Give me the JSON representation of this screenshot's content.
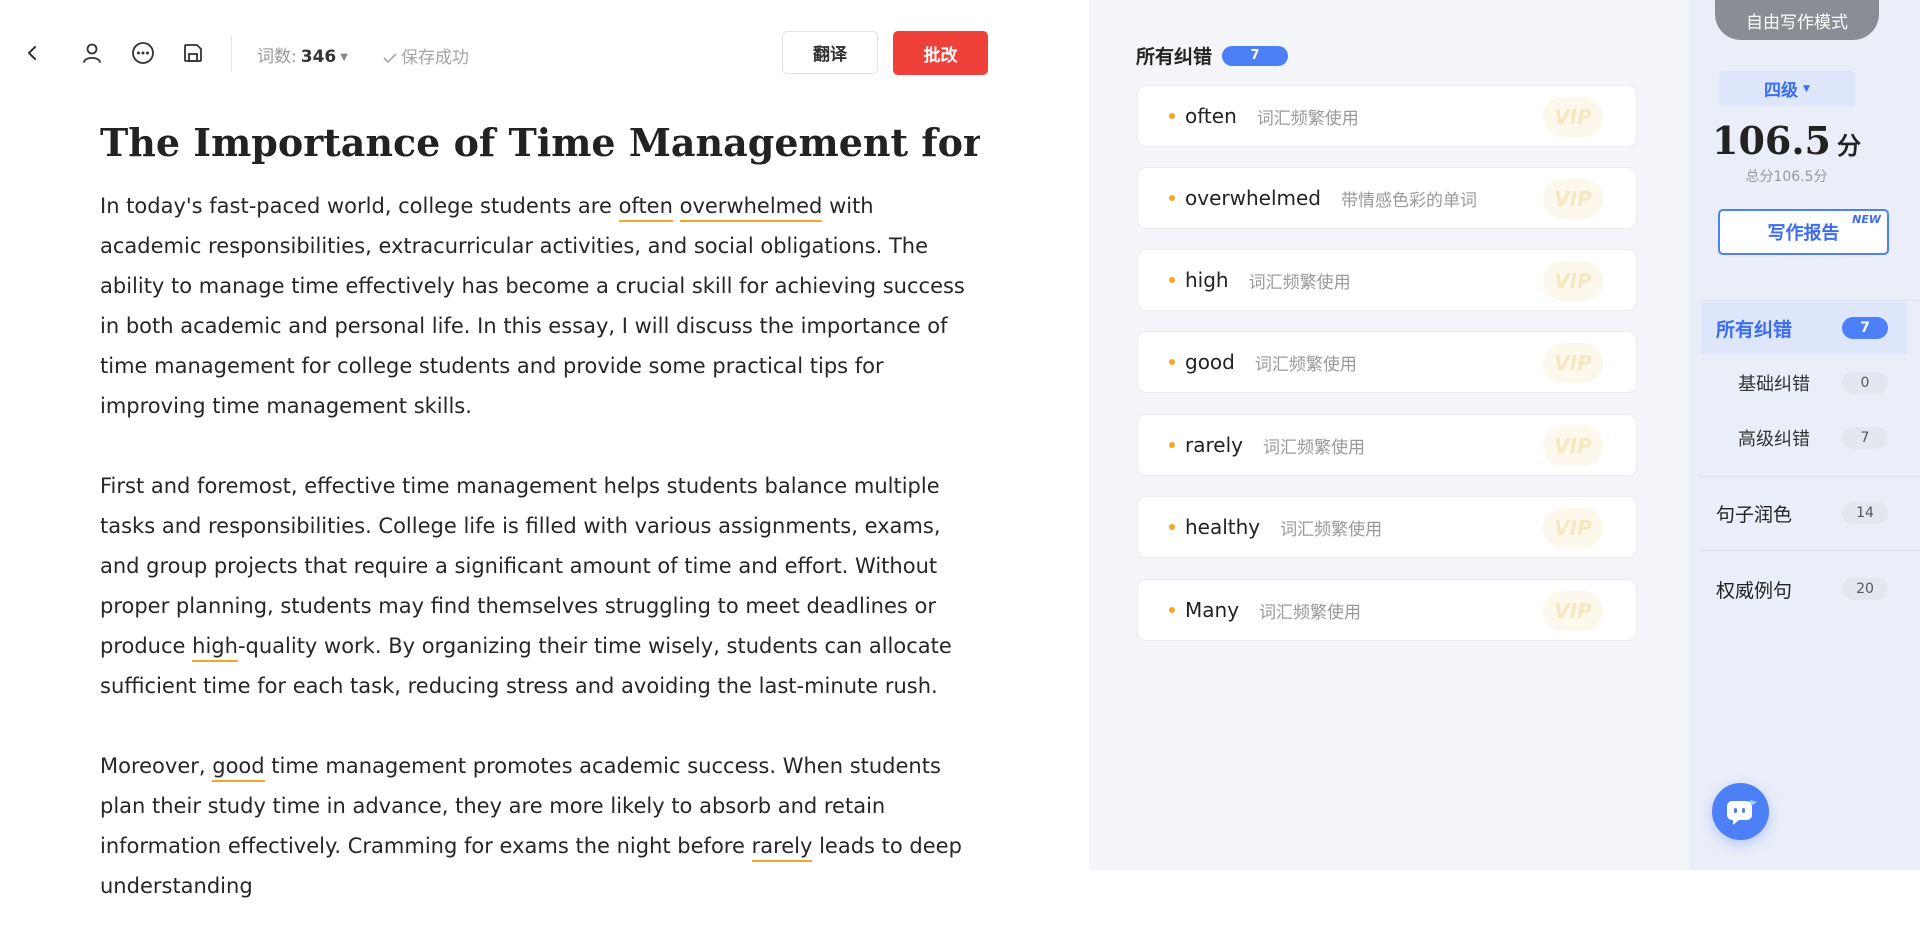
{
  "toolbar": {
    "word_count_label": "词数:",
    "word_count_value": "346",
    "save_status": "保存成功",
    "translate_label": "翻译",
    "correct_label": "批改"
  },
  "document": {
    "title": "The Importance of Time Management for Coll...",
    "p1": {
      "s1": "In today's fast-paced world, college students are ",
      "w1": "often",
      "s2": " ",
      "w2": "overwhelmed",
      "s3": " with academic responsibilities, extracurricular activities, and social obligations. The ability to manage time effectively has become a crucial skill for achieving success in both academic and personal life. In this essay, I will discuss the importance of time management for college students and provide some practical tips for improving time management skills."
    },
    "p2": {
      "s1": "First and foremost, effective time management helps students balance multiple tasks and responsibilities. College life is filled with various assignments, exams, and group projects that require a significant amount of time and effort. Without proper planning, students may find themselves struggling to meet deadlines or produce ",
      "w1": "high",
      "s2": "-quality work. By organizing their time wisely, students can allocate sufficient time for each task, reducing stress and avoiding the last-minute rush."
    },
    "p3": {
      "s1": "Moreover, ",
      "w1": "good",
      "s2": " time management promotes academic success. When students plan their study time in advance, they are more likely to absorb and retain information effectively. Cramming for exams the night before ",
      "w2": "rarely",
      "s3": " leads to deep understanding"
    }
  },
  "errors_panel": {
    "title": "所有纠错",
    "count": "7",
    "vip_label": "VIP",
    "items": [
      {
        "word": "often",
        "type": "词汇频繁使用"
      },
      {
        "word": "overwhelmed",
        "type": "带情感色彩的单词"
      },
      {
        "word": "high",
        "type": "词汇频繁使用"
      },
      {
        "word": "good",
        "type": "词汇频繁使用"
      },
      {
        "word": "rarely",
        "type": "词汇频繁使用"
      },
      {
        "word": "healthy",
        "type": "词汇频繁使用"
      },
      {
        "word": "Many",
        "type": "词汇频繁使用"
      }
    ]
  },
  "sidebar": {
    "mode_label": "自由写作模式",
    "level": "四级",
    "score": "106.5",
    "score_unit": "分",
    "score_sub": "总分106.5分",
    "report_label": "写作报告",
    "report_tag": "NEW",
    "nav": [
      {
        "label": "所有纠错",
        "count": "7"
      },
      {
        "label": "基础纠错",
        "count": "0"
      },
      {
        "label": "高级纠错",
        "count": "7"
      },
      {
        "label": "句子润色",
        "count": "14"
      },
      {
        "label": "权威例句",
        "count": "20"
      }
    ]
  },
  "colors": {
    "accent": "#4d7ff7",
    "danger": "#ef4139",
    "highlight": "#f5a623"
  }
}
